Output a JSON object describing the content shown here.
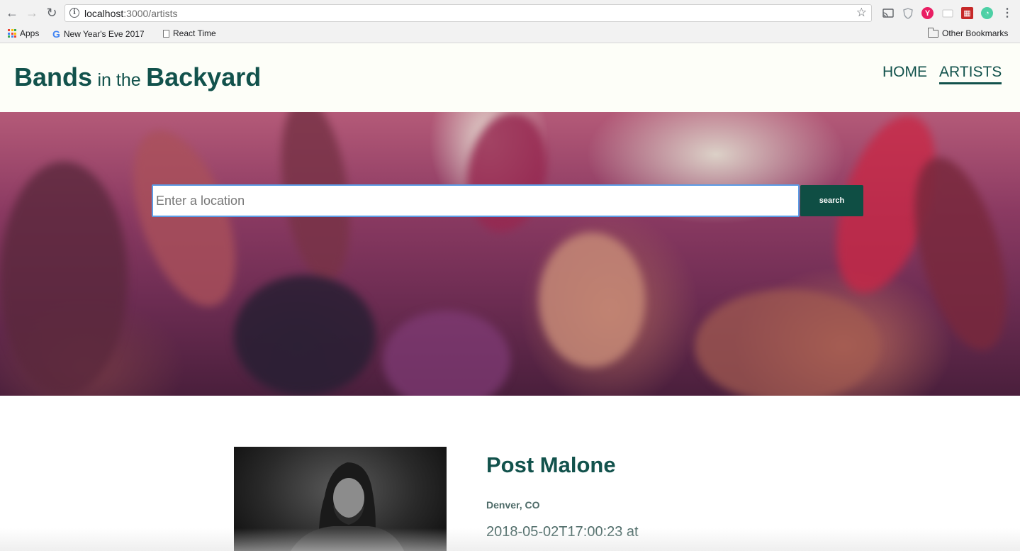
{
  "browser": {
    "url_host": "localhost",
    "url_path": ":3000/artists",
    "bookmarks": [
      {
        "label": "Apps",
        "icon": "apps-grid-icon"
      },
      {
        "label": "New Year's Eve 2017",
        "icon": "google-icon"
      },
      {
        "label": "React Time",
        "icon": "page-icon"
      }
    ],
    "other_bookmarks": "Other Bookmarks"
  },
  "site": {
    "brand_word1": "Bands",
    "brand_joiner": "in the",
    "brand_word2": "Backyard",
    "nav": [
      {
        "label": "HOME",
        "active": false
      },
      {
        "label": "ARTISTS",
        "active": true
      }
    ],
    "accent_color": "#12524c"
  },
  "search": {
    "placeholder": "Enter a location",
    "value": "",
    "button_label": "search"
  },
  "artist": {
    "name": "Post Malone",
    "location": "Denver, CO",
    "datetime": "2018-05-02T17:00:23 at"
  }
}
